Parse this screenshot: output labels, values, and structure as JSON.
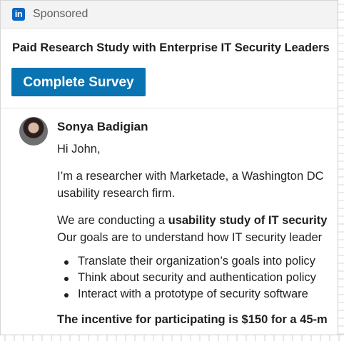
{
  "header": {
    "logo_text": "in",
    "sponsored_label": "Sponsored"
  },
  "message": {
    "subject": "Paid Research Study with Enterprise IT Security Leaders",
    "cta_label": "Complete Survey",
    "sender_name": "Sonya Badigian",
    "greeting": "Hi John,",
    "para1_line1": "I’m a researcher with Marketade, a Washington DC",
    "para1_line2": "usability research firm.",
    "para2_line1_prefix": "We are conducting a ",
    "para2_line1_bold": "usability study of IT security",
    "para2_line2": "Our goals are to understand how IT security leader",
    "bullets": [
      "Translate their organization’s goals into policy",
      "Think about security and authentication policy",
      "Interact with a prototype of security software"
    ],
    "incentive_text": "The incentive for participating is $150 for a 45-m"
  },
  "colors": {
    "brand_blue": "#0a66c2",
    "cta_blue": "#0a73b1"
  }
}
